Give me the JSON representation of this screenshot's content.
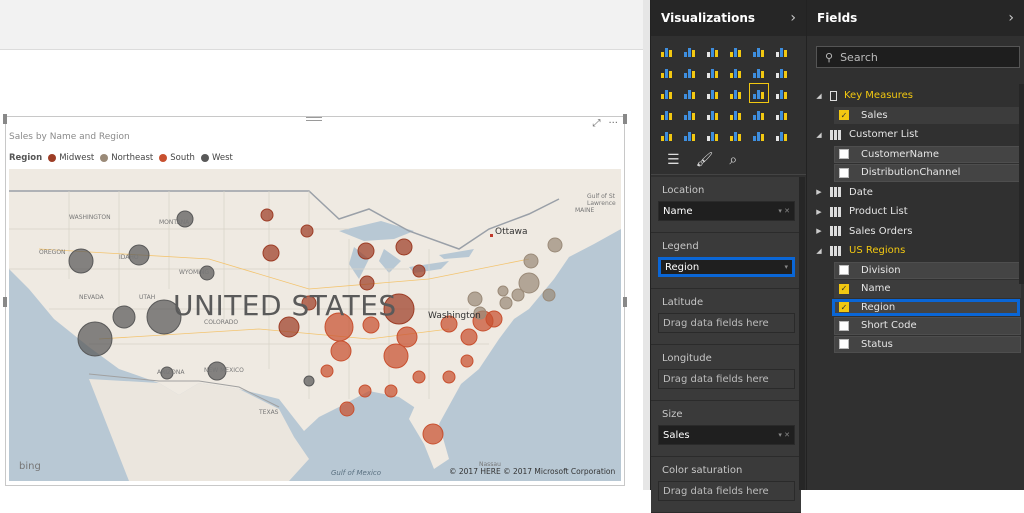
{
  "visual": {
    "title": "Sales by Name and Region",
    "legend_title": "Region",
    "legend": [
      {
        "name": "Midwest",
        "color": "#9d3d26"
      },
      {
        "name": "Northeast",
        "color": "#9a8a78"
      },
      {
        "name": "South",
        "color": "#c8502f"
      },
      {
        "name": "West",
        "color": "#595959"
      }
    ],
    "map_label": "UNITED STATES",
    "city_label": "Ottawa",
    "city_label2": "Washington",
    "gulf": "Gulf of Mexico",
    "bing": "bing",
    "copyright": "© 2017 HERE  © 2017 Microsoft Corporation",
    "states": [
      "WASHINGTON",
      "MONTANA",
      "OREGON",
      "IDAHO",
      "WYOMING",
      "NEVADA",
      "UTAH",
      "COLORADO",
      "ARIZONA",
      "NEW MEXICO",
      "TEXAS",
      "MAINE",
      "Gulf of St Lawrence",
      "Nassau"
    ]
  },
  "visualizations": {
    "title": "Visualizations",
    "tabs": [
      "fields-tab-icon",
      "format-paint-icon",
      "analytics-icon"
    ],
    "wells": [
      {
        "label": "Location",
        "value": "Name"
      },
      {
        "label": "Legend",
        "value": "Region"
      },
      {
        "label": "Latitude",
        "value": "Drag data fields here"
      },
      {
        "label": "Longitude",
        "value": "Drag data fields here"
      },
      {
        "label": "Size",
        "value": "Sales"
      },
      {
        "label": "Color saturation",
        "value": "Drag data fields here"
      }
    ]
  },
  "fields": {
    "title": "Fields",
    "search_placeholder": "Search",
    "key_measures": "Key Measures",
    "sales": "Sales",
    "customer_list": "Customer List",
    "customer_name": "CustomerName",
    "distribution_channel": "DistributionChannel",
    "date": "Date",
    "product_list": "Product List",
    "sales_orders": "Sales Orders",
    "us_regions": "US Regions",
    "division": "Division",
    "name": "Name",
    "region": "Region",
    "short_code": "Short Code",
    "status": "Status"
  }
}
